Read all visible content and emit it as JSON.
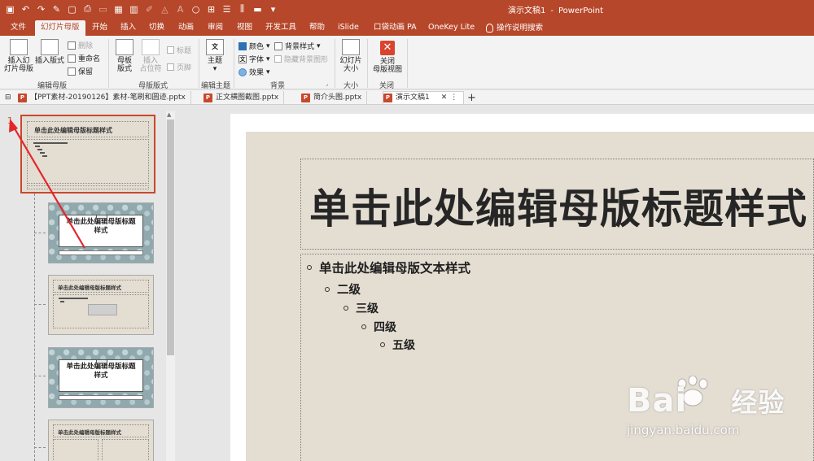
{
  "titlebar": {
    "doc_title": "演示文稿1",
    "separator": "-",
    "app_name": "PowerPoint"
  },
  "tabs": [
    "文件",
    "幻灯片母版",
    "开始",
    "插入",
    "切换",
    "动画",
    "审阅",
    "视图",
    "开发工具",
    "帮助",
    "iSlide",
    "口袋动画 PA",
    "OneKey Lite",
    "操作说明搜索"
  ],
  "ribbon": {
    "insert_master": "插入幻\n灯片母版",
    "insert_master_l1": "插入幻",
    "insert_master_l2": "灯片母版",
    "insert_layout": "插入版式",
    "delete": "删除",
    "rename": "重命名",
    "preserve": "保留",
    "group_edit_master": "编辑母版",
    "master_layout_l1": "母板",
    "master_layout_l2": "版式",
    "insert_placeholder_l1": "插入",
    "insert_placeholder_l2": "占位符",
    "title_chk": "标题",
    "footer_chk": "页脚",
    "group_master_layout": "母版版式",
    "theme": "主题",
    "group_edit_theme": "编辑主题",
    "colors": "颜色",
    "fonts": "字体",
    "effects": "效果",
    "bg_styles": "背景样式",
    "hide_bg": "隐藏背景图形",
    "group_background": "背景",
    "slide_size_l1": "幻灯片",
    "slide_size_l2": "大小",
    "group_size": "大小",
    "close_master_l1": "关闭",
    "close_master_l2": "母版视图",
    "group_close": "关闭"
  },
  "doc_tabs": [
    {
      "label": "【PPT素材-20190126】素材-笔刷和圆迹.pptx",
      "active": false
    },
    {
      "label": "正文横图截图.pptx",
      "active": false
    },
    {
      "label": "简介头图.pptx",
      "active": false
    },
    {
      "label": "演示文稿1",
      "active": true
    }
  ],
  "thumbnails": {
    "slide_number": "1",
    "master_title": "单击此处编辑母版标题样式",
    "layout_title_l1": "单击此处编辑母版标题",
    "layout_title_l2": "样式",
    "small_title": "单击此处编辑母版标题样式"
  },
  "slide": {
    "title": "单击此处编辑母版标题样式",
    "bullets": [
      {
        "level": 1,
        "text": "单击此处编辑母版文本样式"
      },
      {
        "level": 2,
        "text": "二级"
      },
      {
        "level": 3,
        "text": "三级"
      },
      {
        "level": 4,
        "text": "四级"
      },
      {
        "level": 5,
        "text": "五级"
      }
    ]
  },
  "watermark": {
    "brand": "Bai 经验",
    "brand_left": "Bai",
    "brand_right": "经验",
    "url": "jingyan.baidu.com"
  },
  "colors": {
    "accent": "#b7472a",
    "selection": "#c8482d",
    "slide_bg": "#e4ddd2"
  }
}
